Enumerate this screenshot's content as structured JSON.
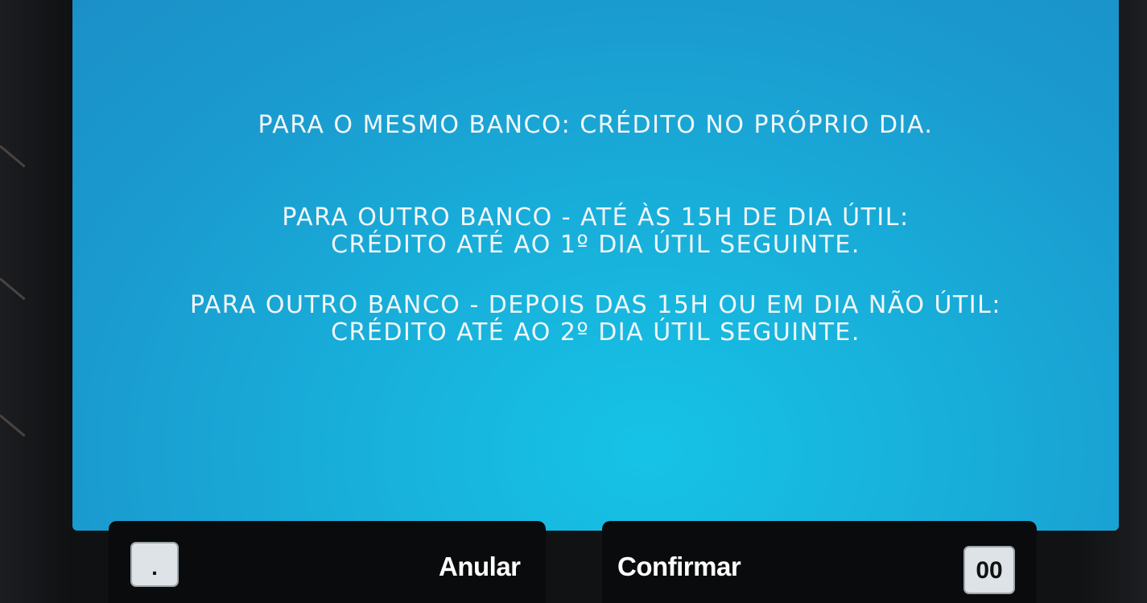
{
  "message": {
    "line1": "PARA O MESMO BANCO: CRÉDITO NO PRÓPRIO DIA.",
    "line2": "PARA OUTRO BANCO - ATÉ ÀS 15H DE DIA ÚTIL:",
    "line3": "CRÉDITO ATÉ AO 1º DIA ÚTIL SEGUINTE.",
    "line4": "PARA OUTRO BANCO - DEPOIS DAS 15H OU EM DIA NÃO ÚTIL:",
    "line5": "CRÉDITO ATÉ AO 2º DIA ÚTIL SEGUINTE."
  },
  "softkeys": {
    "cancel_label": "Anular",
    "confirm_label": "Confirmar"
  },
  "keypad": {
    "dot_key": ".",
    "double_zero_key": "00"
  },
  "colors": {
    "screen_background": "#18b0db",
    "text": "#f2f6f8",
    "softkey_bar": "#0a0b0c"
  }
}
